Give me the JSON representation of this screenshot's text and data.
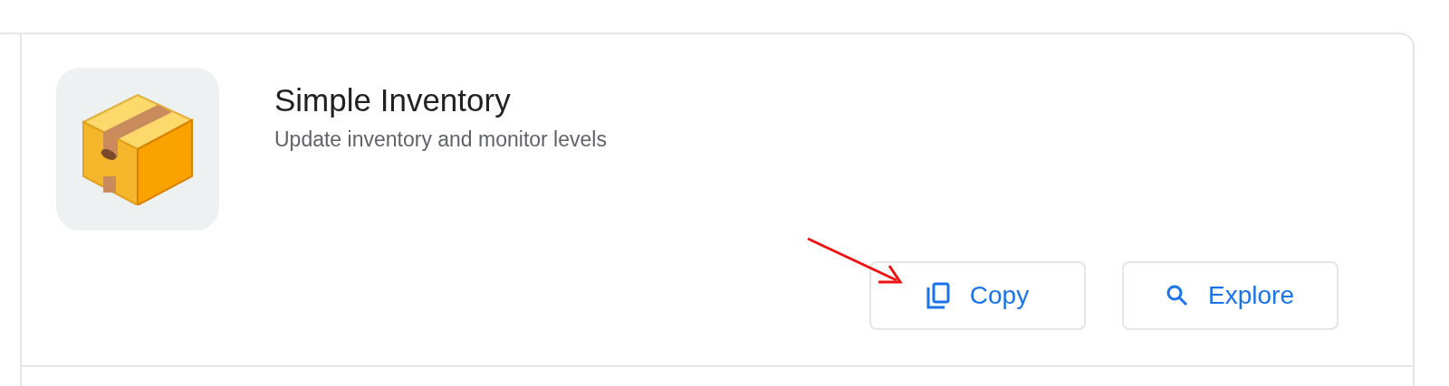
{
  "app": {
    "title": "Simple Inventory",
    "description": "Update inventory and monitor levels"
  },
  "buttons": [
    {
      "kind": "copy",
      "label": "Copy"
    },
    {
      "kind": "explore",
      "label": "Explore"
    }
  ]
}
